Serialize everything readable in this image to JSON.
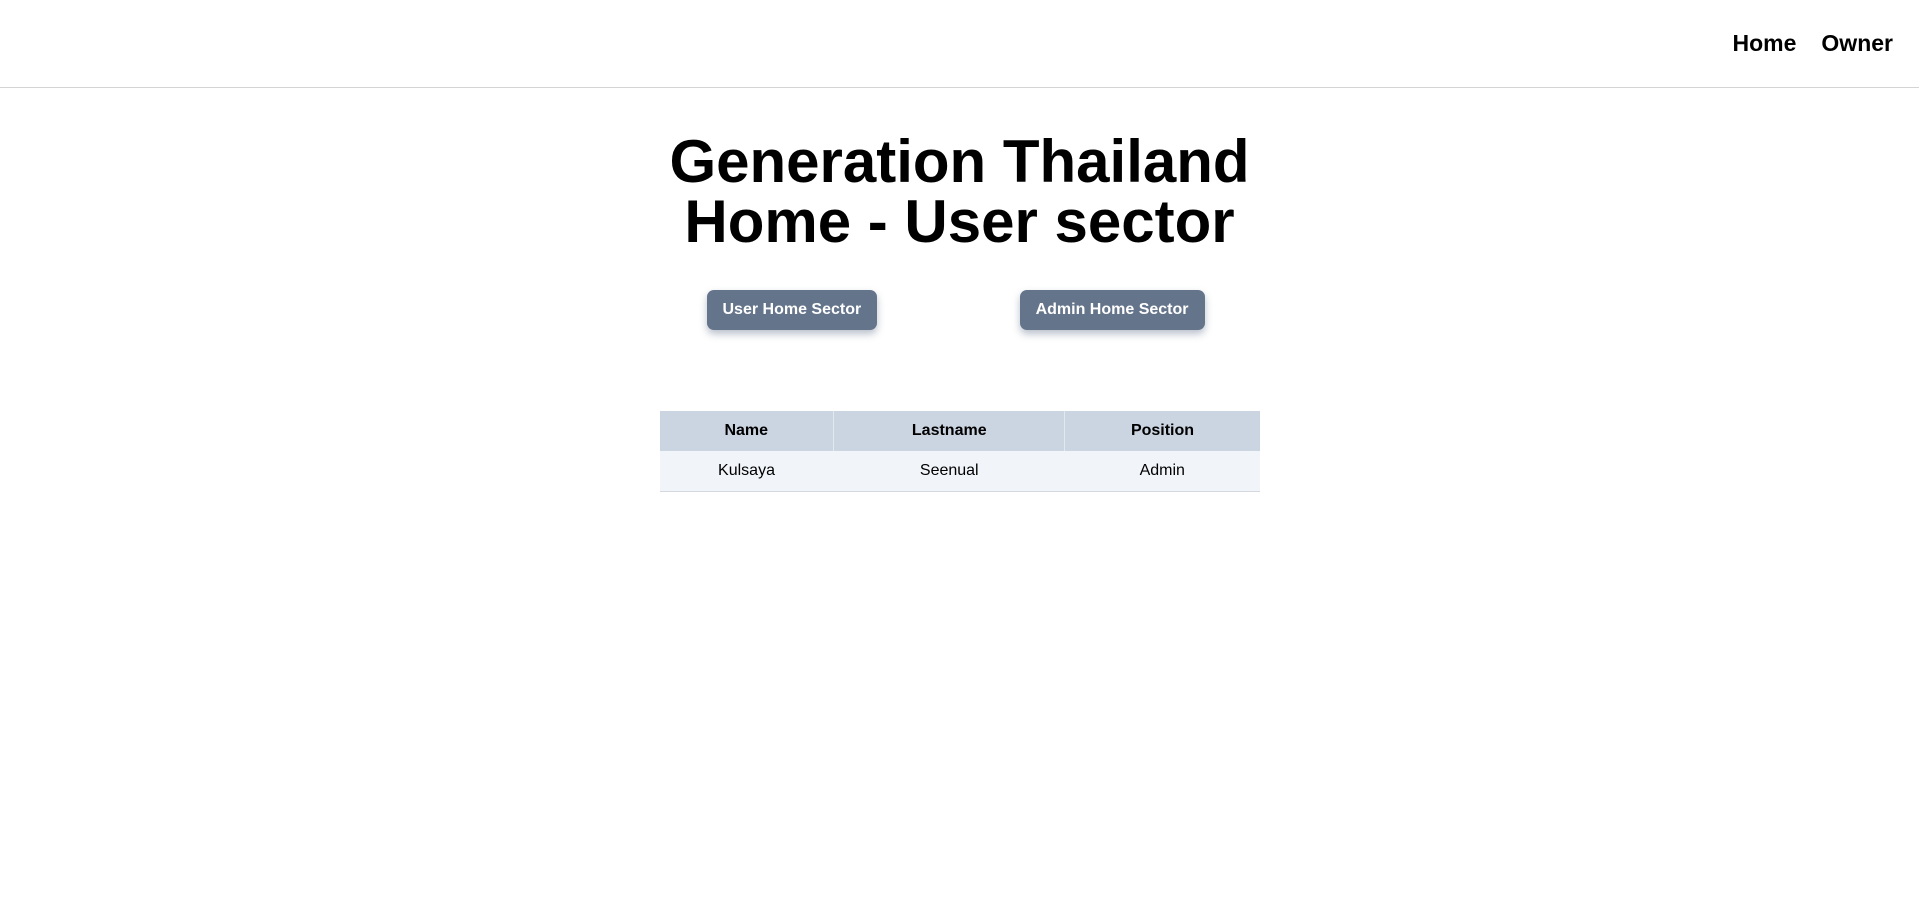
{
  "nav": {
    "links": [
      {
        "label": "Home"
      },
      {
        "label": "Owner"
      }
    ]
  },
  "main": {
    "title_line1": "Generation Thailand",
    "title_line2": "Home - User sector",
    "buttons": {
      "user_home": "User Home Sector",
      "admin_home": "Admin Home Sector"
    },
    "table": {
      "headers": [
        "Name",
        "Lastname",
        "Position"
      ],
      "rows": [
        [
          "Kulsaya",
          "Seenual",
          "Admin"
        ]
      ]
    }
  },
  "colors": {
    "button_bg": "#64748b",
    "table_header_bg": "#cbd5e1",
    "table_row_bg": "#f1f5f9"
  }
}
